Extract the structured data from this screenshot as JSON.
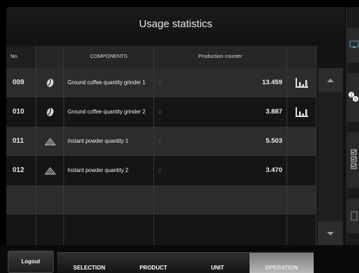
{
  "title": "Usage statistics",
  "header": {
    "no": "No.",
    "components": "COMPONENTS",
    "production_counter": "Production counter"
  },
  "rows": [
    {
      "no": "009",
      "icon": "coffee-bean-icon",
      "component": "Ground coffee quantity grinder 1",
      "unit": "g",
      "value": "13.459",
      "chart": true
    },
    {
      "no": "010",
      "icon": "coffee-bean-icon",
      "component": "Ground coffee quantity grinder 2",
      "unit": "g",
      "value": "3.887",
      "chart": true
    },
    {
      "no": "011",
      "icon": "powder-icon",
      "component": "Instant powder quantity 1",
      "unit": "g",
      "value": "5.503",
      "chart": false
    },
    {
      "no": "012",
      "icon": "powder-icon",
      "component": "Instant powder quantity 2",
      "unit": "g",
      "value": "3.470",
      "chart": false
    }
  ],
  "footer": {
    "logout": "Logout",
    "tabs": [
      {
        "label": "SELECTION",
        "active": false
      },
      {
        "label": "PRODUCT",
        "active": false
      },
      {
        "label": "UNIT",
        "active": false
      },
      {
        "label": "OPERATION",
        "active": true
      }
    ]
  },
  "colors": {
    "teal_column": "#2a5f68",
    "row_dark": "#151515",
    "row_light": "#2c2c2c",
    "active_tab": "#b8b8b8"
  }
}
